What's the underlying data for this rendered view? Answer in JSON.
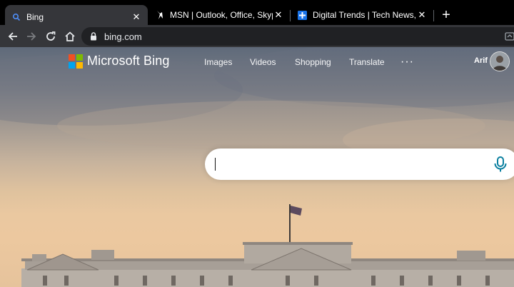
{
  "browser": {
    "tabs": [
      {
        "title": "Bing",
        "active": true,
        "icon": "bing-search-icon"
      },
      {
        "title": "MSN | Outlook, Office, Skype, Bing",
        "active": false,
        "icon": "msn-icon"
      },
      {
        "title": "Digital Trends | Tech News, Reviews",
        "active": false,
        "icon": "digital-trends-icon"
      }
    ],
    "new_tab_label": "+",
    "close_glyph": "✕",
    "address": "bing.com"
  },
  "page": {
    "brand": "Microsoft Bing",
    "nav": [
      "Images",
      "Videos",
      "Shopping",
      "Translate"
    ],
    "more_label": "···",
    "user_name": "Arif",
    "search": {
      "value": "",
      "placeholder": ""
    },
    "colors": {
      "logo_red": "#f25022",
      "logo_green": "#7fba00",
      "logo_blue": "#00a4ef",
      "logo_yellow": "#ffb900",
      "mic": "#0a7f9f",
      "tab_active": "#35363a",
      "tab_strip": "#000000"
    }
  }
}
